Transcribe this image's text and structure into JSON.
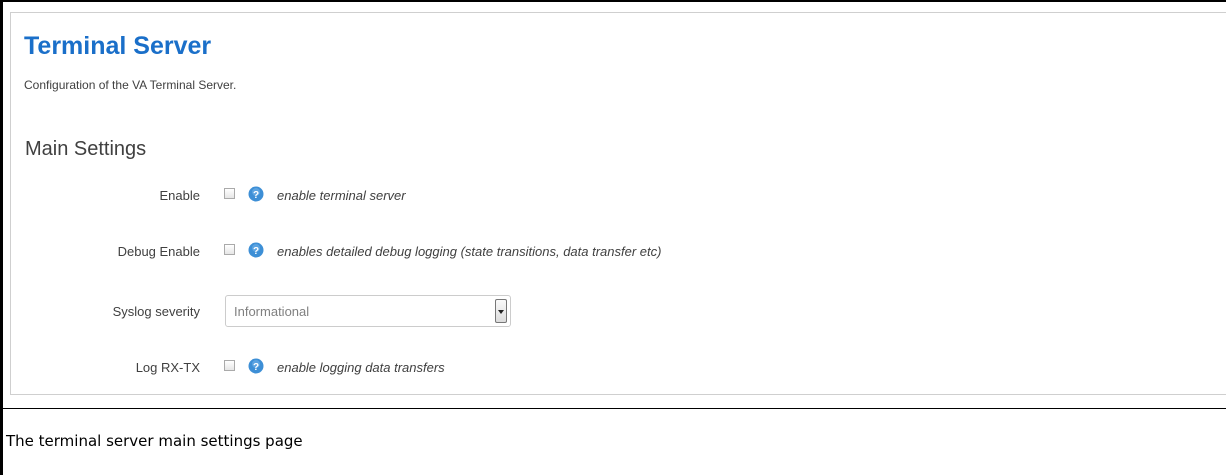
{
  "page": {
    "title": "Terminal Server",
    "description": "Configuration of the VA Terminal Server."
  },
  "section": {
    "title": "Main Settings"
  },
  "fields": {
    "enable": {
      "label": "Enable",
      "checked": false,
      "hint": "enable terminal server"
    },
    "debug_enable": {
      "label": "Debug Enable",
      "checked": false,
      "hint": "enables detailed debug logging (state transitions, data transfer etc)"
    },
    "syslog_severity": {
      "label": "Syslog severity",
      "selected": "Informational"
    },
    "log_rx_tx": {
      "label": "Log RX-TX",
      "checked": false,
      "hint": "enable logging data transfers"
    }
  },
  "caption": "The terminal server main settings page",
  "colors": {
    "title": "#1a6fc9",
    "help_icon": "#3d8fd6",
    "text": "#404040"
  },
  "icons": {
    "help": "help-circle-icon",
    "dropdown": "chevron-down-icon"
  }
}
